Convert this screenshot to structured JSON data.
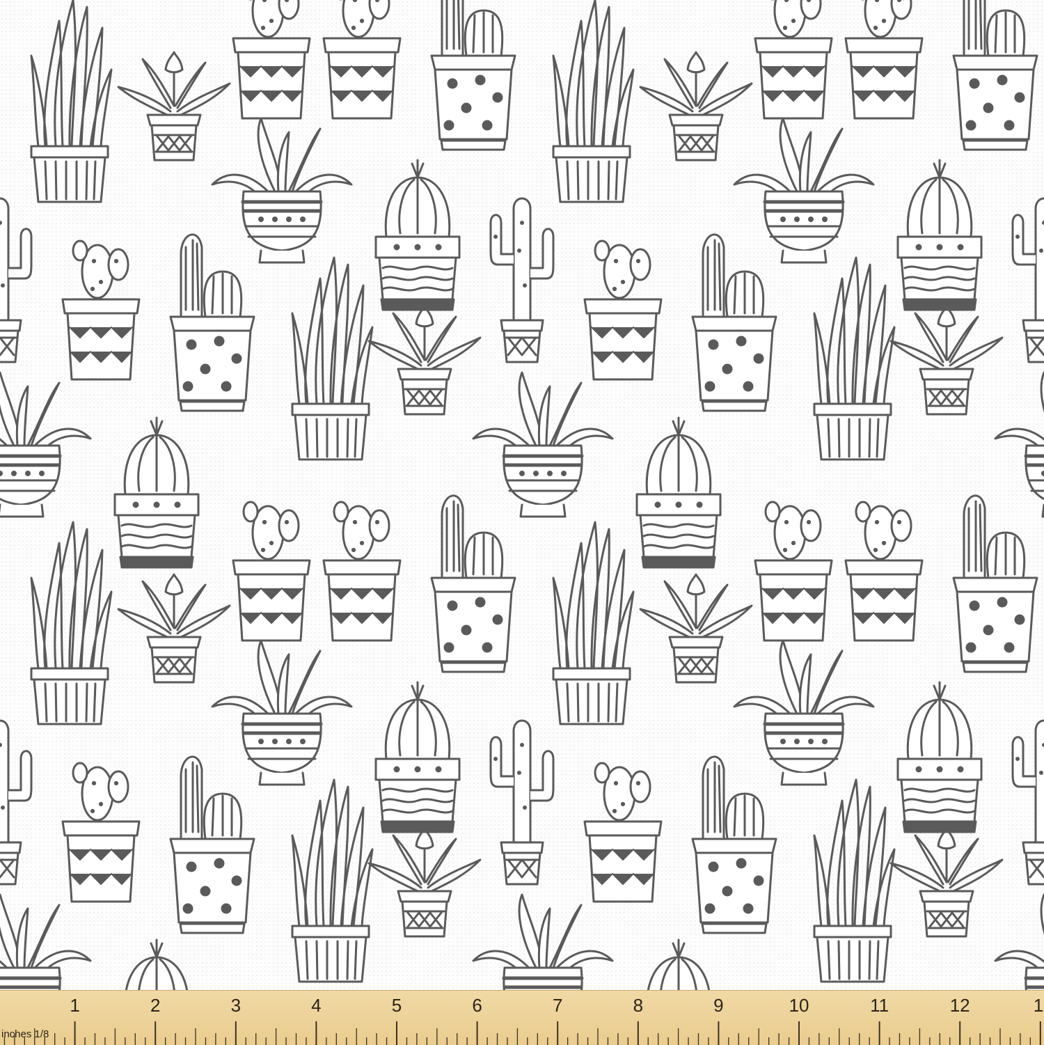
{
  "image": {
    "subject": "fabric-swatch",
    "motif_colors": {
      "ink": "#5a5a5a",
      "background": "#fdfdfd"
    }
  },
  "ruler": {
    "unit_label": "inches 1/8",
    "numbers": [
      "1",
      "2",
      "3",
      "4",
      "5",
      "6",
      "7",
      "8",
      "9",
      "10",
      "11",
      "12",
      "1"
    ],
    "color": "#ecd197"
  }
}
